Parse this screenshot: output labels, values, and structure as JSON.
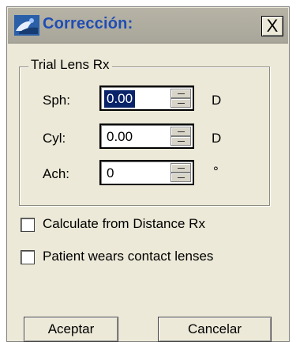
{
  "window": {
    "title": "Corrección:",
    "close_label": "X",
    "icon": "app-lens-icon"
  },
  "trial_lens": {
    "group_title": "Trial Lens Rx",
    "rows": [
      {
        "label": "Sph:",
        "value": "0.00",
        "unit": "D",
        "selected": true
      },
      {
        "label": "Cyl:",
        "value": "0.00",
        "unit": "D",
        "selected": false
      },
      {
        "label": "Ach:",
        "value": "0",
        "unit": "°",
        "selected": false
      }
    ]
  },
  "options": [
    {
      "label": "Calculate from Distance Rx",
      "checked": false
    },
    {
      "label": "Patient wears contact lenses",
      "checked": false
    }
  ],
  "buttons": {
    "accept_label": "Aceptar",
    "cancel_label": "Cancelar"
  },
  "colors": {
    "title_text": "#1f4db3",
    "selection": "#0a246a",
    "dialog_bg": "#ece9d8"
  }
}
